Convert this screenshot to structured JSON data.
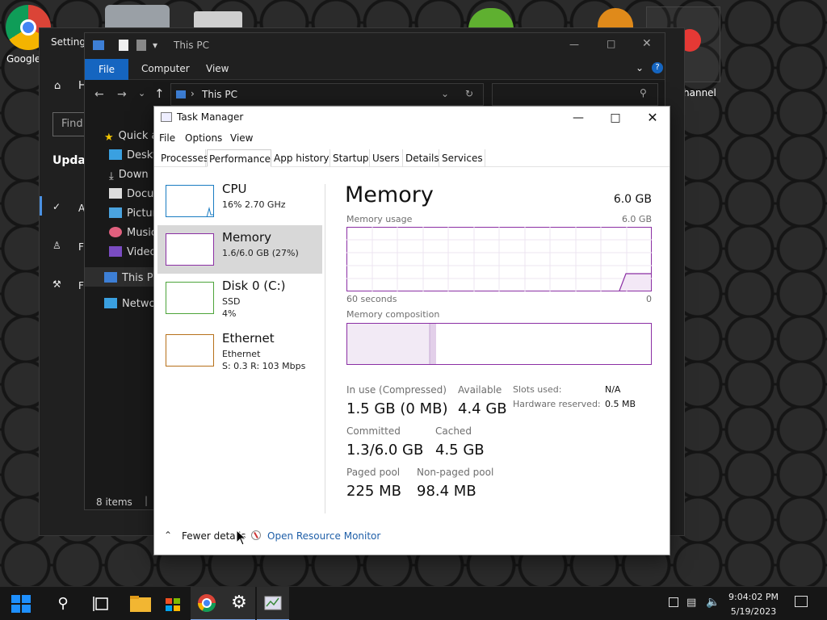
{
  "desktop": {
    "icons": [
      {
        "label": "Google",
        "icon": "chrome-icon"
      },
      {
        "label": "hannel",
        "icon": "youtube-channel-icon"
      }
    ]
  },
  "settings_window": {
    "title": "Settings",
    "search_placeholder": "Find",
    "section": "Updat",
    "nav_fragments": [
      "H",
      "A",
      "Fi",
      "Fe"
    ]
  },
  "explorer": {
    "title": "This PC",
    "ribbon_tabs": [
      "File",
      "Computer",
      "View"
    ],
    "address": "This PC",
    "nav_items": [
      {
        "label": "Quick a",
        "icon": "star-icon"
      },
      {
        "label": "Deskt",
        "icon": "desktop-folder-icon"
      },
      {
        "label": "Down",
        "icon": "download-icon"
      },
      {
        "label": "Docu",
        "icon": "document-icon"
      },
      {
        "label": "Pictur",
        "icon": "pictures-icon"
      },
      {
        "label": "Music",
        "icon": "music-icon"
      },
      {
        "label": "Video",
        "icon": "video-icon"
      },
      {
        "label": "This PC",
        "icon": "computer-icon"
      },
      {
        "label": "Netwo",
        "icon": "network-icon"
      }
    ],
    "status_items": "8 items",
    "status_sep": "|"
  },
  "task_manager": {
    "title": "Task Manager",
    "menu": [
      "File",
      "Options",
      "View"
    ],
    "tabs": [
      "Processes",
      "Performance",
      "App history",
      "Startup",
      "Users",
      "Details",
      "Services"
    ],
    "active_tab": "Performance",
    "resources": [
      {
        "name": "CPU",
        "line1": "16%  2.70 GHz",
        "line2": "",
        "color": "#1a7cc2"
      },
      {
        "name": "Memory",
        "line1": "1.6/6.0 GB (27%)",
        "line2": "",
        "color": "#8b2fa4"
      },
      {
        "name": "Disk 0 (C:)",
        "line1": "SSD",
        "line2": "4%",
        "color": "#4da43a"
      },
      {
        "name": "Ethernet",
        "line1": "Ethernet",
        "line2": "S: 0.3  R: 103 Mbps",
        "color": "#b7701a"
      }
    ],
    "detail": {
      "heading": "Memory",
      "capacity": "6.0 GB",
      "usage_label": "Memory usage",
      "usage_max": "6.0 GB",
      "time_span": "60 seconds",
      "time_end": "0",
      "composition_label": "Memory composition",
      "composition": {
        "in_use_fraction": 0.27,
        "modified_fraction": 0.02
      },
      "stats": {
        "in_use_label": "In use (Compressed)",
        "in_use_value": "1.5 GB (0 MB)",
        "available_label": "Available",
        "available_value": "4.4 GB",
        "committed_label": "Committed",
        "committed_value": "1.3/6.0 GB",
        "cached_label": "Cached",
        "cached_value": "4.5 GB",
        "paged_label": "Paged pool",
        "paged_value": "225 MB",
        "nonpaged_label": "Non-paged pool",
        "nonpaged_value": "98.4 MB",
        "slots_label": "Slots used:",
        "slots_value": "N/A",
        "hw_label": "Hardware reserved:",
        "hw_value": "0.5 MB"
      }
    },
    "footer": {
      "fewer_details": "Fewer details",
      "open_monitor": "Open Resource Monitor"
    },
    "accent": "#8b2fa4"
  },
  "taskbar": {
    "time": "9:04:02 PM",
    "date": "5/19/2023",
    "apps": [
      "start-button",
      "search-button",
      "task-view-button",
      "file-explorer-button",
      "store-button",
      "chrome-button",
      "settings-button",
      "task-manager-button"
    ]
  }
}
